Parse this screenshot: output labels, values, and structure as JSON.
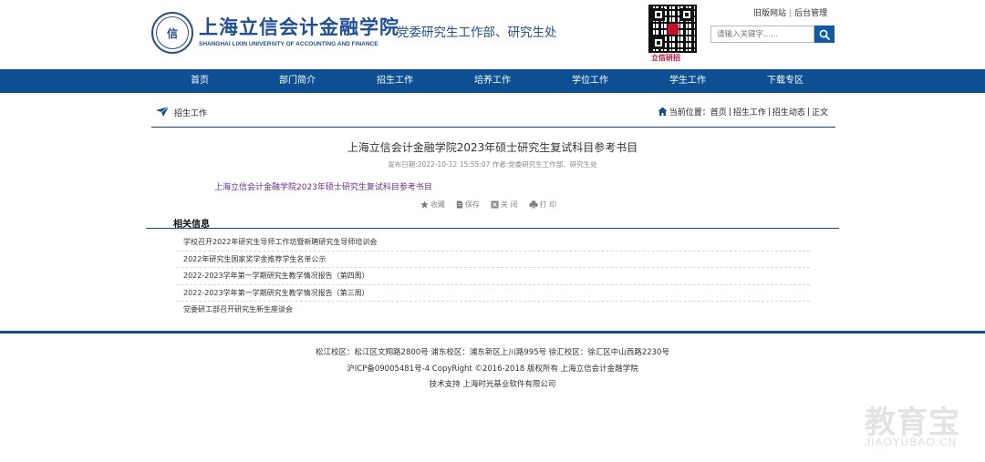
{
  "header": {
    "school_name": "上海立信会计金融学院",
    "school_name_en": "SHANGHAI LIXIN UNIVERSITY OF ACCOUNTING AND FINANCE",
    "seal_text": "信",
    "department": "党委研究生工作部、研究生处",
    "qr_caption": "立信研招",
    "links": {
      "old_site": "旧版网站",
      "sep": "|",
      "admin": "后台管理"
    },
    "search": {
      "placeholder": "请输入关键字......"
    }
  },
  "nav": {
    "items": [
      {
        "label": "首页"
      },
      {
        "label": "部门简介"
      },
      {
        "label": "招生工作"
      },
      {
        "label": "培养工作"
      },
      {
        "label": "学位工作"
      },
      {
        "label": "学生工作"
      },
      {
        "label": "下载专区"
      }
    ]
  },
  "location": {
    "section_title": "招生工作",
    "prefix": "当前位置：",
    "crumbs": [
      "首页",
      "招生工作",
      "招生动态",
      "正文"
    ],
    "sep": "|"
  },
  "article": {
    "title": "上海立信会计金融学院2023年硕士研究生复试科目参考书目",
    "meta": "发布日期:2022-10-12 15:55:07   作者:党委研究生工作部、研究生处",
    "attachment": "上海立信会计金融学院2023年硕士研究生复试科目参考书目",
    "tools": {
      "favorite": "收藏",
      "save": "保存",
      "close": "关 闭",
      "print": "打 印"
    }
  },
  "related": {
    "heading": "相关信息",
    "items": [
      "学校召开2022年研究生导师工作坊暨新聘研究生导师培训会",
      "2022年研究生国家奖学金推荐学生名单公示",
      "2022-2023学年第一学期研究生教学情况报告（第四周）",
      "2022-2023学年第一学期研究生教学情况报告（第三周）",
      "党委研工部召开研究生新生座谈会"
    ]
  },
  "footer": {
    "address": "松江校区：松江区文翔路2800号 浦东校区：浦东新区上川路995号 徐汇校区：徐汇区中山西路2230号",
    "icp": "沪ICP备09005481号-4 CopyRight ©2016-2018 版权所有 上海立信会计金融学院",
    "support": "技术支持   上海时光基业软件有限公司"
  },
  "watermark": {
    "cn": "教育宝",
    "en": "JIAOYUBAO.CN"
  },
  "colors": {
    "nav_blue": "#0c4f92",
    "brand_blue": "#1f4f9a",
    "link_purple": "#6a2d91"
  }
}
